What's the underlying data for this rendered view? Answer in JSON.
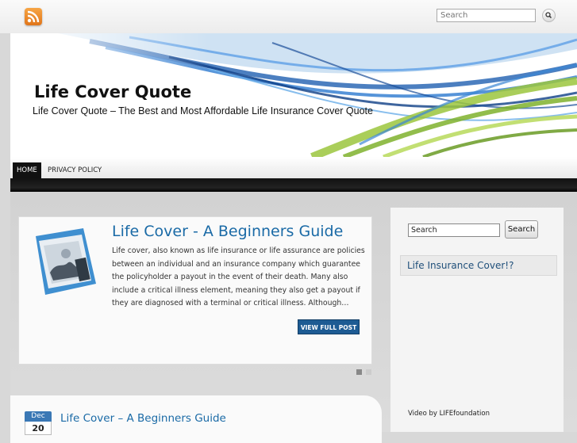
{
  "top_bar": {
    "rss_icon": "rss-feed-icon",
    "search_placeholder": "Search",
    "search_button_icon": "magnifier-icon"
  },
  "header": {
    "site_title": "Life Cover Quote",
    "site_description": "Life Cover Quote – The Best and Most Affordable Life Insurance Cover Quote"
  },
  "nav": {
    "items": [
      {
        "label": "HOME",
        "active": true
      },
      {
        "label": "PRIVACY POLICY",
        "active": false
      }
    ]
  },
  "featured": {
    "title": "Life Cover - A Beginners Guide",
    "excerpt": "Life cover, also known as life insurance or life assurance are policies between an individual and an insurance company which guarantee the policyholder a payout in the event of their death. Many also include a critical illness element, meaning they also get a payout if they are diagnosed with a terminal or critical illness. Although…",
    "button_label": "VIEW FULL POST",
    "icon": "picture-document-icon",
    "slides": 2,
    "active_slide": 1
  },
  "post": {
    "date_month": "Dec",
    "date_day": "20",
    "title": "Life Cover – A Beginners Guide"
  },
  "sidebar": {
    "search_value": "Search",
    "search_button": "Search",
    "widget_title": "Life Insurance Cover!?",
    "video_credit": "Video by LIFEfoundation"
  },
  "colors": {
    "link_blue": "#1a6aa6",
    "button_blue": "#1d5b93",
    "nav_active": "#111111",
    "rss_orange": "#f08a2c"
  }
}
